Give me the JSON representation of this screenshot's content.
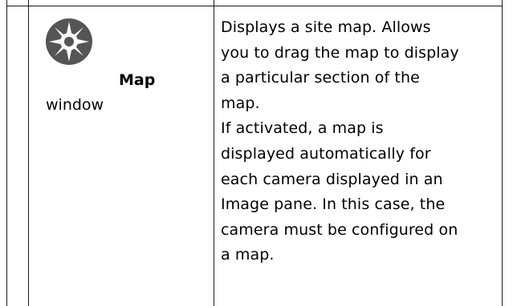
{
  "row": {
    "icon": "compass-map-icon",
    "term_bold": "Map",
    "term_rest": "window",
    "description_lines": [
      "Displays a site map. Allows",
      "you to drag the map to display",
      "a particular section of the",
      "map.",
      "If activated, a map is",
      "displayed automatically for",
      "each camera displayed in an",
      "Image pane. In this case, the",
      "camera must be configured on",
      "a map."
    ]
  },
  "colors": {
    "border": "#1a1a1a",
    "icon_fill": "#555555",
    "text": "#000000"
  }
}
